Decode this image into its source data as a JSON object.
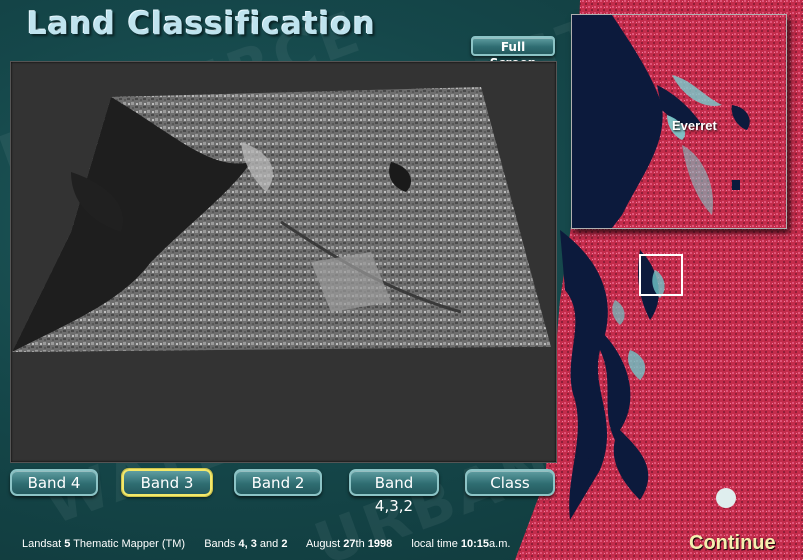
{
  "app": {
    "title": "Land Classification"
  },
  "toolbar": {
    "full_screen_label": "Full Screen"
  },
  "bands": [
    {
      "label": "Band 4",
      "selected": false
    },
    {
      "label": "Band 3",
      "selected": true
    },
    {
      "label": "Band 2",
      "selected": false
    },
    {
      "label": "Band 4,3,2",
      "selected": false
    },
    {
      "label": "Class",
      "selected": false
    }
  ],
  "status": {
    "satellite_prefix": "Landsat",
    "satellite_number": "5",
    "sensor": "Thematic Mapper (TM)",
    "bands_prefix": "Bands",
    "band_a": "4,",
    "band_b": "3",
    "bands_and": "and",
    "band_c": "2",
    "date_prefix": "August",
    "date_day": "27",
    "date_suffix": "th",
    "date_year": "1998",
    "time_prefix": "local time",
    "time_value": "10:15",
    "time_suffix": "a.m."
  },
  "inset": {
    "place_label": "Everret"
  },
  "nav": {
    "continue_label": "Continue"
  },
  "colors": {
    "background": "#15474a",
    "button_fill": "#2f6d72",
    "selected_border": "#f3e86a",
    "continue_text": "#f5f0b0",
    "imagery_red": "#c02a48",
    "imagery_water": "#0c1a3c"
  }
}
